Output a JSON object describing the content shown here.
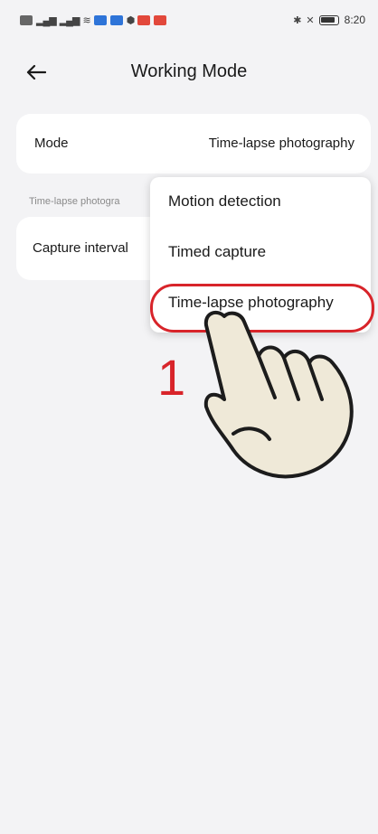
{
  "status_bar": {
    "time": "8:20"
  },
  "header": {
    "title": "Working Mode"
  },
  "mode_row": {
    "label": "Mode",
    "value": "Time-lapse photography"
  },
  "section": {
    "label": "Time-lapse photogra"
  },
  "interval_row": {
    "label": "Capture interval"
  },
  "dropdown": {
    "options": [
      "Motion detection",
      "Timed capture",
      "Time-lapse photography"
    ]
  },
  "annotation": {
    "step": "1",
    "color": "#d8242a"
  },
  "icons": {
    "back": "arrow-left-icon",
    "hand": "pointing-hand-icon"
  }
}
